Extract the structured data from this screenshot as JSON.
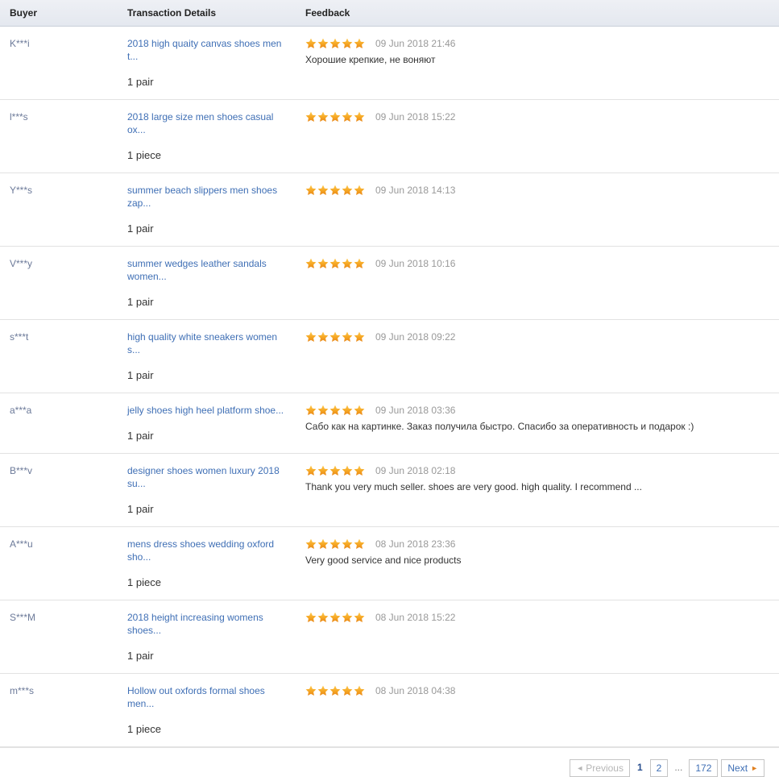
{
  "table": {
    "columns": [
      {
        "key": "buyer",
        "label": "Buyer"
      },
      {
        "key": "transaction",
        "label": "Transaction Details"
      },
      {
        "key": "feedback",
        "label": "Feedback"
      }
    ],
    "rows": [
      {
        "buyer": "K***i",
        "product": "2018 high quaity canvas shoes men t...",
        "quantity": "1 pair",
        "rating": 5,
        "date": "09 Jun 2018 21:46",
        "comment": "Хорошие крепкие, не воняют"
      },
      {
        "buyer": "l***s",
        "product": "2018 large size men shoes casual ox...",
        "quantity": "1 piece",
        "rating": 5,
        "date": "09 Jun 2018 15:22",
        "comment": ""
      },
      {
        "buyer": "Y***s",
        "product": "summer beach slippers men shoes zap...",
        "quantity": "1 pair",
        "rating": 5,
        "date": "09 Jun 2018 14:13",
        "comment": ""
      },
      {
        "buyer": "V***y",
        "product": "summer wedges leather sandals women...",
        "quantity": "1 pair",
        "rating": 5,
        "date": "09 Jun 2018 10:16",
        "comment": ""
      },
      {
        "buyer": "s***t",
        "product": "high quality white sneakers women s...",
        "quantity": "1 pair",
        "rating": 5,
        "date": "09 Jun 2018 09:22",
        "comment": ""
      },
      {
        "buyer": "a***a",
        "product": "jelly shoes high heel platform shoe...",
        "quantity": "1 pair",
        "rating": 5,
        "date": "09 Jun 2018 03:36",
        "comment": "Сабо как на картинке. Заказ получила быстро. Спасибо за оперативность и подарок :)"
      },
      {
        "buyer": "B***v",
        "product": "designer shoes women luxury 2018 su...",
        "quantity": "1 pair",
        "rating": 5,
        "date": "09 Jun 2018 02:18",
        "comment": "Thank you very much seller. shoes are very good. high quality. I recommend ..."
      },
      {
        "buyer": "A***u",
        "product": "mens dress shoes wedding oxford sho...",
        "quantity": "1 piece",
        "rating": 5,
        "date": "08 Jun 2018 23:36",
        "comment": "Very good service and nice products"
      },
      {
        "buyer": "S***M",
        "product": "2018 height increasing womens shoes...",
        "quantity": "1 pair",
        "rating": 5,
        "date": "08 Jun 2018 15:22",
        "comment": ""
      },
      {
        "buyer": "m***s",
        "product": "Hollow out oxfords formal shoes men...",
        "quantity": "1 piece",
        "rating": 5,
        "date": "08 Jun 2018 04:38",
        "comment": ""
      }
    ]
  },
  "pagination": {
    "previous_label": "Previous",
    "next_label": "Next",
    "ellipsis": "...",
    "current_page": "1",
    "pages": [
      "2"
    ],
    "last_page": "172",
    "previous_arrow": "◄",
    "next_arrow": "►"
  },
  "colors": {
    "link": "#3f6fb5",
    "buyer": "#6c7a99",
    "star": "#f5a623",
    "header_bg": "#e9ecf2",
    "row_border": "#e2e2e2",
    "date": "#999999"
  },
  "icons": {
    "star": "star-icon",
    "prev_arrow": "triangle-left-icon",
    "next_arrow": "triangle-right-icon"
  }
}
